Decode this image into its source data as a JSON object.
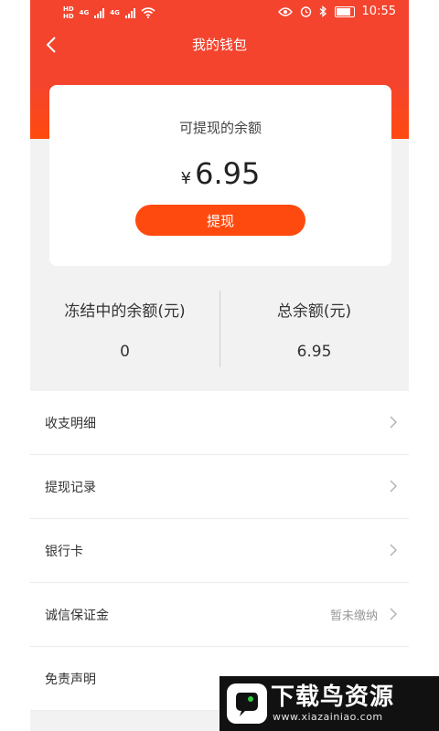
{
  "status_bar": {
    "network": [
      "HD",
      "HD"
    ],
    "signal_labels": [
      "4G",
      "4G"
    ],
    "time": "10:55"
  },
  "header": {
    "title": "我的钱包",
    "back_icon": "chevron-left-icon"
  },
  "balance_card": {
    "label": "可提现的余额",
    "currency": "¥",
    "amount": "6.95",
    "withdraw_button": "提现"
  },
  "stats": [
    {
      "label": "冻结中的余额(元)",
      "value": "0"
    },
    {
      "label": "总余额(元)",
      "value": "6.95"
    }
  ],
  "menu": [
    {
      "label": "收支明细",
      "note": ""
    },
    {
      "label": "提现记录",
      "note": ""
    },
    {
      "label": "银行卡",
      "note": ""
    },
    {
      "label": "诚信保证金",
      "note": "暂未缴纳"
    },
    {
      "label": "免责声明",
      "note": ""
    }
  ],
  "watermark": {
    "title": "下载鸟资源",
    "url": "www.xiazainiao.com"
  },
  "colors": {
    "primary": "#f4442e",
    "button": "#ff4a0f",
    "page_bg": "#f2f2f2"
  }
}
